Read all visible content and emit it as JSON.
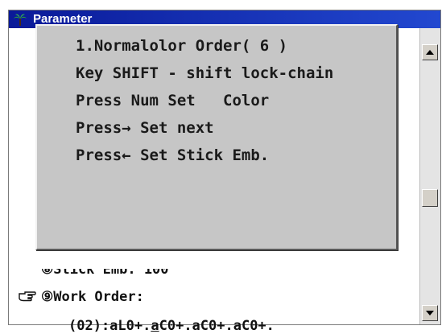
{
  "window": {
    "title": "Parameter",
    "accent": "#0a1a98"
  },
  "popup": {
    "lines": [
      "1.Normalolor Order( 6 )",
      "Key SHIFT - shift lock-chain",
      "Press Num Set   Color",
      "Press→ Set next",
      "Press← Set Stick Emb."
    ]
  },
  "content": {
    "partial_line": "⑧Stick Emb: 100",
    "work_order_label": "⑨Work Order:",
    "work_order_value_prefix": "(02):aL0+.",
    "work_order_value_underlined": "a",
    "work_order_value_suffix": "C0+.aC0+.aC0+."
  },
  "icons": {
    "app": "palm-tree-icon",
    "pointer": "pointing-hand-icon",
    "scroll_up": "arrow-up-icon",
    "scroll_down": "arrow-down-icon"
  }
}
